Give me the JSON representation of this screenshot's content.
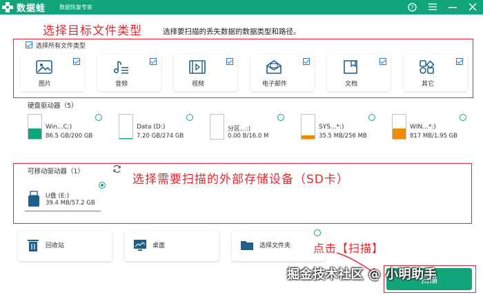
{
  "app": {
    "name": "数据蛙",
    "subtitle": "数据恢复专家"
  },
  "colors": {
    "brand": "#12a47a",
    "annotation": "#e6262e"
  },
  "annotations": {
    "heading1": "选择目标文件类型",
    "heading2": "选择需要扫描的外部存储设备（SD卡）",
    "heading3": "点击【扫描】"
  },
  "instruction": "选择要扫描的丢失数据的数据类型和路径。",
  "select_all_label": "选择所有文件类型",
  "file_types": [
    {
      "label": "图片",
      "icon": "image-icon"
    },
    {
      "label": "音频",
      "icon": "music-icon"
    },
    {
      "label": "视频",
      "icon": "video-icon"
    },
    {
      "label": "电子邮件",
      "icon": "email-icon"
    },
    {
      "label": "文档",
      "icon": "document-icon"
    },
    {
      "label": "其它",
      "icon": "other-icon"
    }
  ],
  "hard_drives": {
    "header": "硬盘驱动器（5）",
    "items": [
      {
        "name": "Win...C:)",
        "size": "86.5 GB/200 GB",
        "fill": 0.43,
        "fill_color": "#12a47a"
      },
      {
        "name": "Data (D:)",
        "size": "7.20 GB/274 GB",
        "fill": 0.03,
        "fill_color": "#12a47a"
      },
      {
        "name": "分区...:)",
        "size": "0.00  B/16.0 M",
        "fill": 0.0,
        "fill_color": "#12a47a"
      },
      {
        "name": "SYS...*:)",
        "size": "35.5 MB/256 MB",
        "fill": 0.14,
        "fill_color": "#f08a00"
      },
      {
        "name": "WIN...*:)",
        "size": "817 MB/1.95 GB",
        "fill": 0.42,
        "fill_color": "#f08a00"
      }
    ]
  },
  "removable": {
    "header": "可移动驱动器（1）",
    "refresh_icon": "refresh-icon",
    "items": [
      {
        "name": "U盘 (E:)",
        "size": "39.4 MB/57.2 GB",
        "selected": true
      }
    ]
  },
  "locations": [
    {
      "label": "回收站",
      "icon": "recycle-bin-icon"
    },
    {
      "label": "桌面",
      "icon": "desktop-icon"
    },
    {
      "label": "选择文件夹",
      "icon": "folder-icon"
    }
  ],
  "scan_button": "扫描",
  "watermark": "掘金技术社区 @ 小明助手"
}
